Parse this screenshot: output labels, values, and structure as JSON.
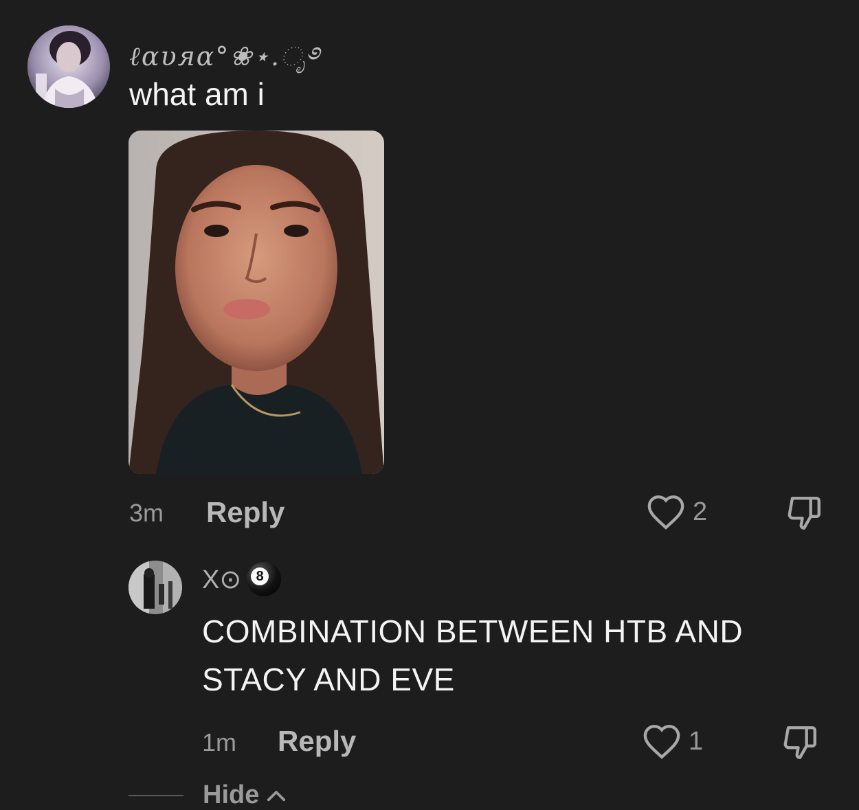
{
  "main_comment": {
    "username": "ℓαυяα°❀⋆.ೃ࿔",
    "text": "what am i",
    "time": "3m",
    "reply_label": "Reply",
    "likes": "2"
  },
  "reply_comment": {
    "username": "X⊙",
    "username_badge": "8",
    "text": "COMBINATION BETWEEN HTB AND STACY AND EVE",
    "time": "1m",
    "reply_label": "Reply",
    "likes": "1"
  },
  "thread": {
    "hide_label": "Hide"
  },
  "icons": {
    "like": "heart-outline-icon",
    "dislike": "thumbs-down-icon",
    "collapse": "chevron-up-icon"
  },
  "colors": {
    "background": "#1d1d1d",
    "text_primary": "#f4f4f4",
    "text_secondary": "#9a9a9a"
  }
}
